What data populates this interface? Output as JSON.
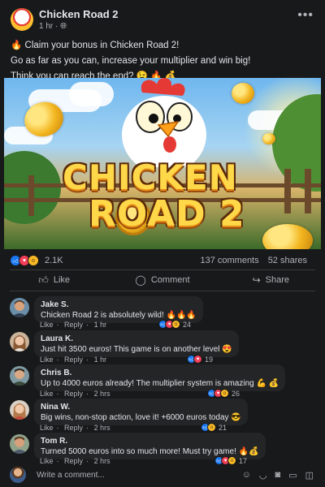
{
  "post": {
    "page_name": "Chicken Road 2",
    "time": "1 hr",
    "privacy_icon": "globe-icon",
    "more_icon": "more-options-icon",
    "caption_line1": "🔥 Claim your bonus in Chicken Road 2!",
    "caption_line2": "Go as far as you can, increase your multiplier and win big!",
    "caption_line3": "Think you can reach the end? 😉 🔥 💰",
    "image_title_line1": "CHICKEN",
    "image_title_line2": "ROAD 2"
  },
  "stats": {
    "reactions": "2.1K",
    "comments": "137 comments",
    "shares": "52 shares"
  },
  "actions": {
    "like": "Like",
    "comment": "Comment",
    "share": "Share"
  },
  "comments": [
    {
      "name": "Jake S.",
      "text": "Chicken Road 2 is absolutely wild! 🔥🔥🔥",
      "like": "Like",
      "reply": "Reply",
      "time": "1 hr",
      "count": "24"
    },
    {
      "name": "Laura K.",
      "text": "Just hit 3500 euros! This game is on another level 😍",
      "like": "Like",
      "reply": "Reply",
      "time": "1 hr",
      "count": "19"
    },
    {
      "name": "Chris B.",
      "text": "Up to 4000 euros already! The multiplier system is amazing 💪 💰",
      "like": "Like",
      "reply": "Reply",
      "time": "2 hrs",
      "count": "26"
    },
    {
      "name": "Nina W.",
      "text": "Big wins, non-stop action, love it! +6000 euros today 😎",
      "like": "Like",
      "reply": "Reply",
      "time": "2 hrs",
      "count": "21"
    },
    {
      "name": "Tom R.",
      "text": "Turned 5000 euros into so much more! Must try game! 🔥💰",
      "like": "Like",
      "reply": "Reply",
      "time": "2 hrs",
      "count": "17"
    }
  ],
  "composer": {
    "placeholder": "Write a comment..."
  },
  "colors": {
    "background": "#18191a",
    "bubble": "#242526",
    "text": "#e4e6eb",
    "muted": "#b0b3b8",
    "like_blue": "#1877f2",
    "love_red": "#f33e58",
    "wow_yellow": "#f7b928"
  }
}
